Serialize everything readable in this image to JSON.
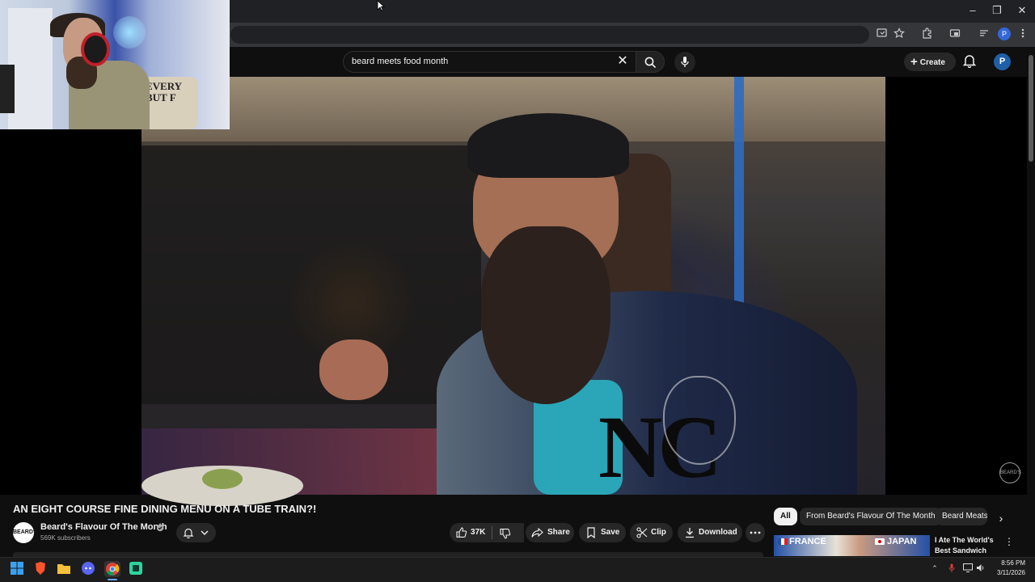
{
  "browser": {
    "window_controls": {
      "minimize": "–",
      "restore": "❐",
      "close": "✕"
    },
    "profile_initial": "P"
  },
  "youtube_header": {
    "search_query": "beard meets food month",
    "create_label": "Create",
    "avatar_initial": "P"
  },
  "webcam_overlay": {
    "chair_text": "EVERY\nBUT F"
  },
  "video": {
    "watermark": "BEARD'S",
    "title": "AN EIGHT COURSE FINE DINING MENU ON A TUBE TRAIN?!",
    "channel": {
      "avatar_text": "BEARD'S",
      "name": "Beard's Flavour Of The Month",
      "subscribers": "569K subscribers"
    },
    "actions": {
      "likes": "37K",
      "share": "Share",
      "save": "Save",
      "clip": "Clip",
      "download": "Download"
    }
  },
  "filter_chips": [
    "All",
    "From Beard's Flavour Of The Month",
    "Beard Meats"
  ],
  "recommendation": {
    "thumb_left": "FRANCE",
    "thumb_right": "JAPAN",
    "title": "I Ate The World's Best Sandwich"
  },
  "taskbar": {
    "time": "8:56 PM",
    "date": "3/11/2026"
  },
  "colors": {
    "background": "#0f0f0f",
    "surface": "#272727",
    "text": "#f1f1f1",
    "secondary_text": "#aaaaaa",
    "avatar_blue": "#1f5fa8"
  }
}
